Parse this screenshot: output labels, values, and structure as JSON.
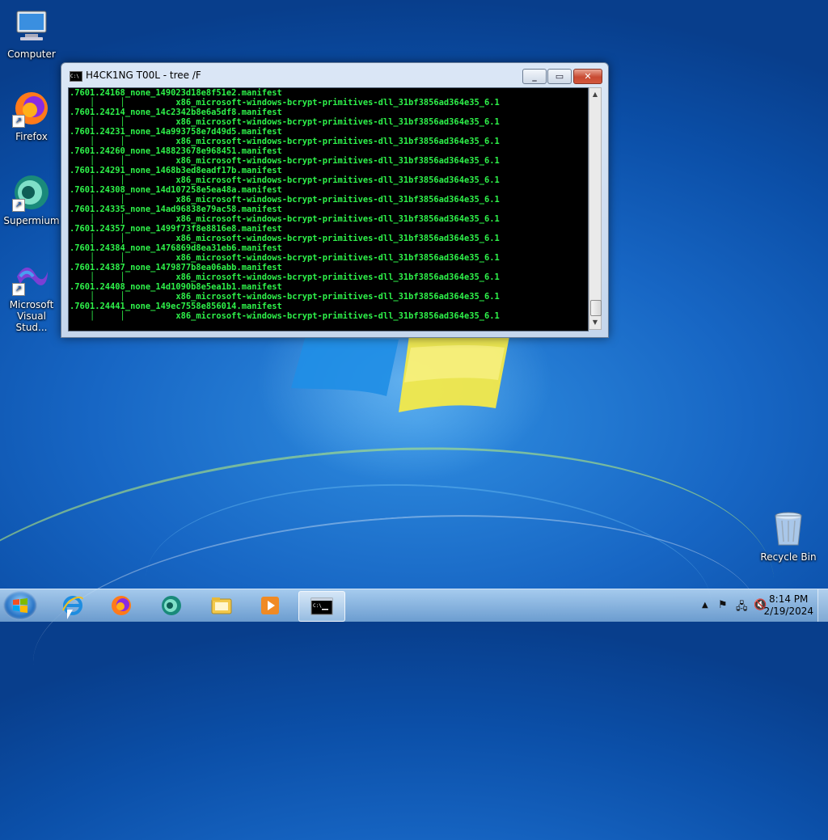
{
  "desktop": {
    "icons": [
      {
        "label": "Computer",
        "icon": "computer-icon"
      },
      {
        "label": "Firefox",
        "icon": "firefox-icon"
      },
      {
        "label": "Supermium",
        "icon": "supermium-icon"
      },
      {
        "label": "Microsoft Visual Stud...",
        "icon": "visual-studio-icon"
      },
      {
        "label": "Recycle Bin",
        "icon": "recycle-bin-icon"
      }
    ]
  },
  "console_window": {
    "title": "H4CK1NG T00L - tree  /F",
    "buttons": {
      "minimize": "minimize-icon",
      "maximize": "maximize-icon",
      "close": "close-icon"
    },
    "lines": [
      ".7601.24168_none_149023d18e8f51e2.manifest",
      "    │     │          x86_microsoft-windows-bcrypt-primitives-dll_31bf3856ad364e35_6.1",
      ".7601.24214_none_14c2342b8e6a5df8.manifest",
      "    │     │          x86_microsoft-windows-bcrypt-primitives-dll_31bf3856ad364e35_6.1",
      ".7601.24231_none_14a993758e7d49d5.manifest",
      "    │     │          x86_microsoft-windows-bcrypt-primitives-dll_31bf3856ad364e35_6.1",
      ".7601.24260_none_148823678e968451.manifest",
      "    │     │          x86_microsoft-windows-bcrypt-primitives-dll_31bf3856ad364e35_6.1",
      ".7601.24291_none_1468b3ed8eadf17b.manifest",
      "    │     │          x86_microsoft-windows-bcrypt-primitives-dll_31bf3856ad364e35_6.1",
      ".7601.24308_none_14d107258e5ea48a.manifest",
      "    │     │          x86_microsoft-windows-bcrypt-primitives-dll_31bf3856ad364e35_6.1",
      ".7601.24335_none_14ad96838e79ac58.manifest",
      "    │     │          x86_microsoft-windows-bcrypt-primitives-dll_31bf3856ad364e35_6.1",
      ".7601.24357_none_1499f73f8e8816e8.manifest",
      "    │     │          x86_microsoft-windows-bcrypt-primitives-dll_31bf3856ad364e35_6.1",
      ".7601.24384_none_1476869d8ea31eb6.manifest",
      "    │     │          x86_microsoft-windows-bcrypt-primitives-dll_31bf3856ad364e35_6.1",
      ".7601.24387_none_1479877b8ea06abb.manifest",
      "    │     │          x86_microsoft-windows-bcrypt-primitives-dll_31bf3856ad364e35_6.1",
      ".7601.24408_none_14d1090b8e5ea1b1.manifest",
      "    │     │          x86_microsoft-windows-bcrypt-primitives-dll_31bf3856ad364e35_6.1",
      ".7601.24441_none_149ec7558e856014.manifest",
      "    │     │          x86_microsoft-windows-bcrypt-primitives-dll_31bf3856ad364e35_6.1"
    ]
  },
  "taskbar": {
    "start": "windows-start-icon",
    "apps": [
      {
        "icon": "internet-explorer-icon"
      },
      {
        "icon": "firefox-icon"
      },
      {
        "icon": "supermium-icon"
      },
      {
        "icon": "file-explorer-icon"
      },
      {
        "icon": "media-player-icon"
      },
      {
        "icon": "command-prompt-icon",
        "active": true
      }
    ],
    "tray": {
      "icons": [
        "show-hidden-icons-icon",
        "action-center-flag-icon",
        "network-icon",
        "volume-muted-icon"
      ]
    },
    "clock": {
      "time": "8:14 PM",
      "date": "2/19/2024"
    }
  },
  "colors": {
    "console_text": "#2ef24a",
    "console_bg": "#000000",
    "close_button": "#c84a32"
  }
}
